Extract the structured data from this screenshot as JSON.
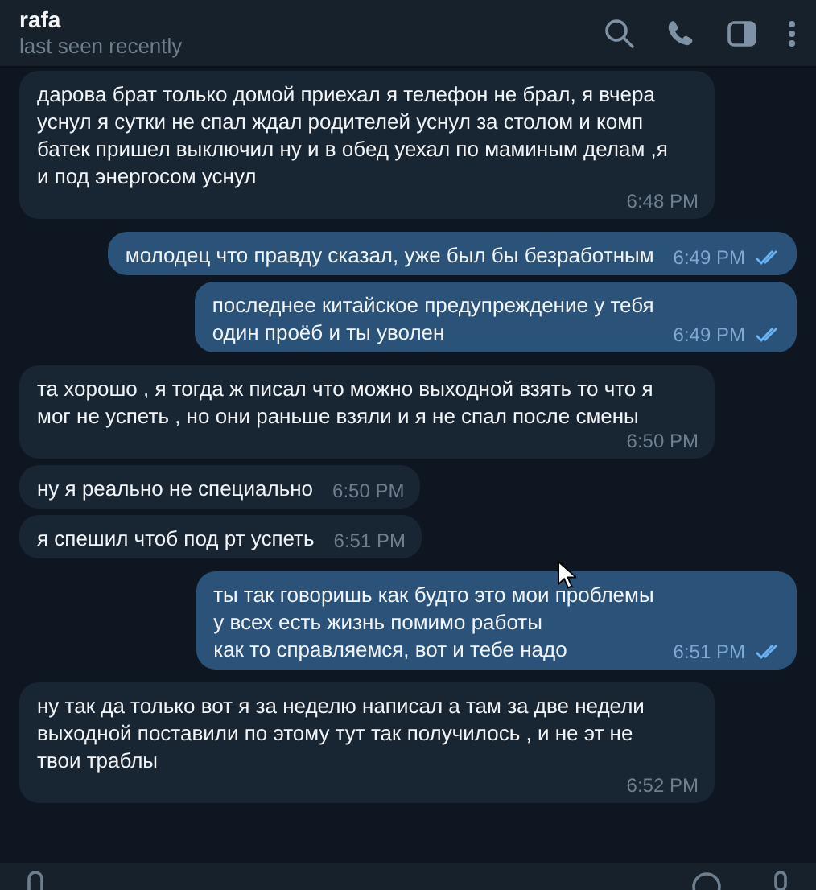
{
  "header": {
    "name": "rafa",
    "status": "last seen recently"
  },
  "messages": [
    {
      "kind": "incoming",
      "text": "дарова брат только домой приехал я телефон не брал, я вчера\nуснул  я сутки не спал ждал родителей уснул за столом и комп\nбатек пришел выключил ну и в обед  уехал по маминым делам ,я\nи под энергосом уснул",
      "time": "6:48 PM"
    },
    {
      "kind": "outgoing",
      "text": "молодец что правду сказал, уже был бы безработным",
      "time": "6:49 PM",
      "read": true
    },
    {
      "kind": "outgoing",
      "text": "последнее китайское предупреждение у тебя\nодин проёб и ты уволен",
      "time": "6:49 PM",
      "read": true
    },
    {
      "kind": "incoming",
      "text": "та хорошо , я тогда ж писал что можно выходной взять то что я\nмог не успеть , но они раньше взяли и я не спал после смены",
      "time": "6:50 PM"
    },
    {
      "kind": "incoming",
      "text": "ну я реально не специально",
      "time": "6:50 PM"
    },
    {
      "kind": "incoming",
      "text": "я спешил чтоб под рт успеть",
      "time": "6:51 PM"
    },
    {
      "kind": "outgoing",
      "text": "ты так говоришь как будто это мои проблемы\nу всех есть жизнь помимо работы\nкак то справляемся, вот и тебе надо",
      "time": "6:51 PM",
      "read": true
    },
    {
      "kind": "incoming",
      "text": "ну так да только вот я за неделю написал а там за две недели\nвыходной поставили по этому тут так получилось , и не эт не\nтвои траблы",
      "time": "6:52 PM"
    }
  ]
}
